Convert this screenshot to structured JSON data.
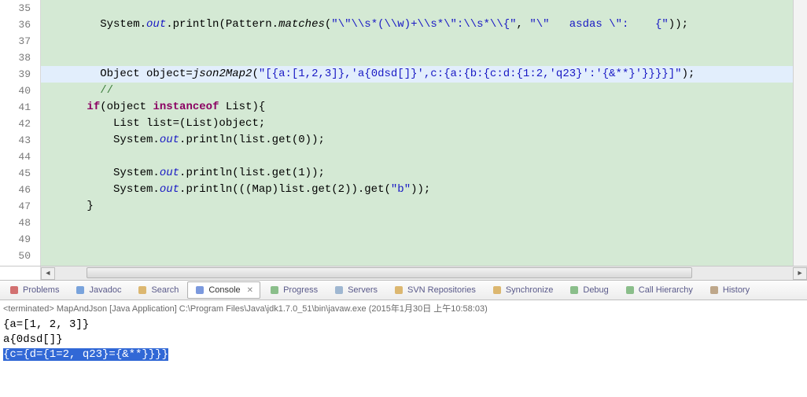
{
  "editor": {
    "lineStart": 35,
    "lines": [
      {
        "n": 35,
        "text": ""
      },
      {
        "n": 36,
        "segments": [
          {
            "t": "        System."
          },
          {
            "t": "out",
            "cls": "field"
          },
          {
            "t": ".println(Pattern."
          },
          {
            "t": "matches",
            "cls": "method-call"
          },
          {
            "t": "("
          },
          {
            "t": "\"\\\"\\\\s*(\\\\w)+\\\\s*\\\":\\\\s*\\\\{\"",
            "cls": "str"
          },
          {
            "t": ", "
          },
          {
            "t": "\"\\\"   asdas \\\":    {\"",
            "cls": "str"
          },
          {
            "t": "));"
          }
        ]
      },
      {
        "n": 37,
        "text": ""
      },
      {
        "n": 38,
        "text": ""
      },
      {
        "n": 39,
        "highlight": true,
        "segments": [
          {
            "t": "        Object object="
          },
          {
            "t": "json2Map2",
            "cls": "method-call"
          },
          {
            "t": "("
          },
          {
            "t": "\"[{a:[1,2,3]},'a{0dsd[]}',c:{a:{b:{c:d:{1:2,'q23}':'{&**}'}}}}]\"",
            "cls": "str"
          },
          {
            "t": ");"
          }
        ]
      },
      {
        "n": 40,
        "segments": [
          {
            "t": "        "
          },
          {
            "t": "//",
            "cls": "comment"
          }
        ]
      },
      {
        "n": 41,
        "segments": [
          {
            "t": "      "
          },
          {
            "t": "if",
            "cls": "kw"
          },
          {
            "t": "(object "
          },
          {
            "t": "instanceof",
            "cls": "kw"
          },
          {
            "t": " List){"
          }
        ]
      },
      {
        "n": 42,
        "segments": [
          {
            "t": "          List list=(List)object;"
          }
        ]
      },
      {
        "n": 43,
        "segments": [
          {
            "t": "          System."
          },
          {
            "t": "out",
            "cls": "field"
          },
          {
            "t": ".println(list.get(0));"
          }
        ]
      },
      {
        "n": 44,
        "text": ""
      },
      {
        "n": 45,
        "segments": [
          {
            "t": "          System."
          },
          {
            "t": "out",
            "cls": "field"
          },
          {
            "t": ".println(list.get(1));"
          }
        ]
      },
      {
        "n": 46,
        "segments": [
          {
            "t": "          System."
          },
          {
            "t": "out",
            "cls": "field"
          },
          {
            "t": ".println(((Map)list.get(2)).get("
          },
          {
            "t": "\"b\"",
            "cls": "str"
          },
          {
            "t": "));"
          }
        ]
      },
      {
        "n": 47,
        "segments": [
          {
            "t": "      }"
          }
        ]
      },
      {
        "n": 48,
        "text": ""
      },
      {
        "n": 49,
        "text": ""
      },
      {
        "n": 50,
        "text": ""
      }
    ]
  },
  "tabs": [
    {
      "icon": "problems",
      "color": "#c94f4f",
      "label": "Problems"
    },
    {
      "icon": "javadoc",
      "color": "#5a8fd6",
      "label": "Javadoc"
    },
    {
      "icon": "search",
      "color": "#d6a74f",
      "label": "Search"
    },
    {
      "icon": "console",
      "color": "#5a7fd6",
      "label": "Console",
      "active": true
    },
    {
      "icon": "progress",
      "color": "#6fb06f",
      "label": "Progress"
    },
    {
      "icon": "servers",
      "color": "#8aa8c8",
      "label": "Servers"
    },
    {
      "icon": "svn",
      "color": "#d6a74f",
      "label": "SVN Repositories"
    },
    {
      "icon": "sync",
      "color": "#d6a74f",
      "label": "Synchronize"
    },
    {
      "icon": "debug",
      "color": "#6fb06f",
      "label": "Debug"
    },
    {
      "icon": "callh",
      "color": "#6fb06f",
      "label": "Call Hierarchy"
    },
    {
      "icon": "history",
      "color": "#b0946f",
      "label": "History"
    }
  ],
  "console": {
    "header": "<terminated> MapAndJson [Java Application] C:\\Program Files\\Java\\jdk1.7.0_51\\bin\\javaw.exe (2015年1月30日 上午10:58:03)",
    "lines": [
      {
        "text": "{a=[1, 2, 3]}"
      },
      {
        "text": "a{0dsd[]}"
      },
      {
        "text": "{c={d={1=2, q23}={&**}}}}",
        "selected": true
      }
    ]
  }
}
